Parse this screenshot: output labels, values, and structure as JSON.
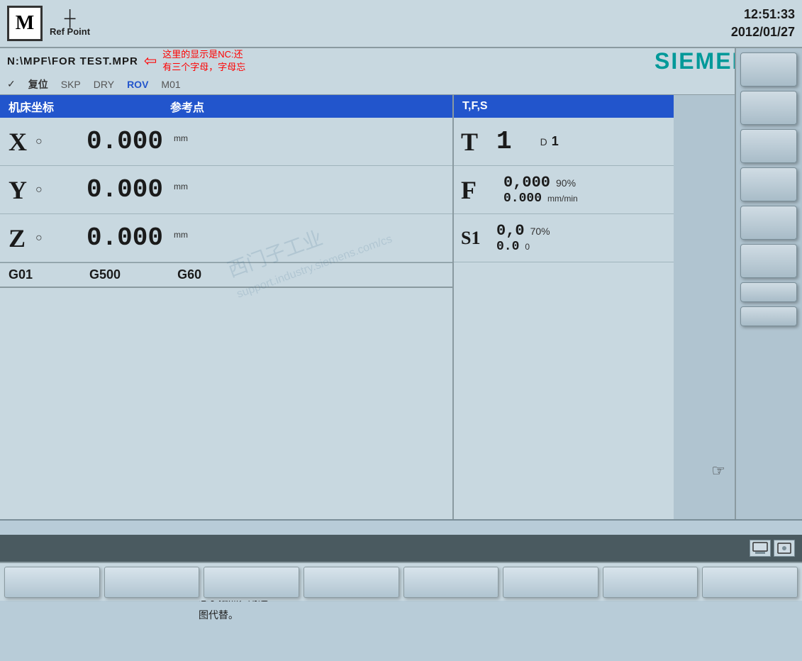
{
  "header": {
    "m_label": "M",
    "ref_point": "Ref Point",
    "crosshair": "⊕",
    "datetime_line1": "12:51:33",
    "datetime_line2": "2012/01/27"
  },
  "filepath": {
    "path": "N:\\MPF\\FOR TEST.MPR",
    "arrow": "⇦",
    "annotation_line1": "这里的显示是NC:还",
    "annotation_line2": "有三个字母，字母忘"
  },
  "siemens": {
    "logo": "SIEMENS"
  },
  "mode_bar": {
    "checkmark": "✓",
    "items": [
      "复位",
      "SKP",
      "DRY",
      "ROV",
      "M01"
    ]
  },
  "coord_table": {
    "header_machine": "机床坐标",
    "header_ref": "参考点",
    "header_tfs": "T,F,S",
    "rows": [
      {
        "axis": "X",
        "circle": "○",
        "value": "0.000",
        "unit": "mm"
      },
      {
        "axis": "Y",
        "circle": "○",
        "value": "0.000",
        "unit": "mm"
      },
      {
        "axis": "Z",
        "circle": "○",
        "value": "0.000",
        "unit": "mm"
      }
    ]
  },
  "tfs": {
    "t_label": "T",
    "t_value": "1",
    "d_label": "D",
    "d_value": "1",
    "f_label": "F",
    "f_value1": "0,000",
    "f_pct": "90%",
    "f_value2": "0.000",
    "f_unit": "mm/min",
    "s_label": "S1",
    "s_value1": "0,0",
    "s_pct": "70%",
    "s_value2": "0.0",
    "s_unit": "0"
  },
  "gcodes": {
    "g1": "G01",
    "g2": "G500",
    "g3": "G60"
  },
  "bottom_panel": {
    "annotation": "这是一通电开机\n后的面板显示\n（原始画面），\n忘了拍照，用这\n图代替。"
  },
  "watermark": {
    "line1": "西门子工业",
    "line2": "support.industry.siemens.com/cs"
  },
  "sidebar_buttons": 8,
  "fkey_buttons": 8
}
